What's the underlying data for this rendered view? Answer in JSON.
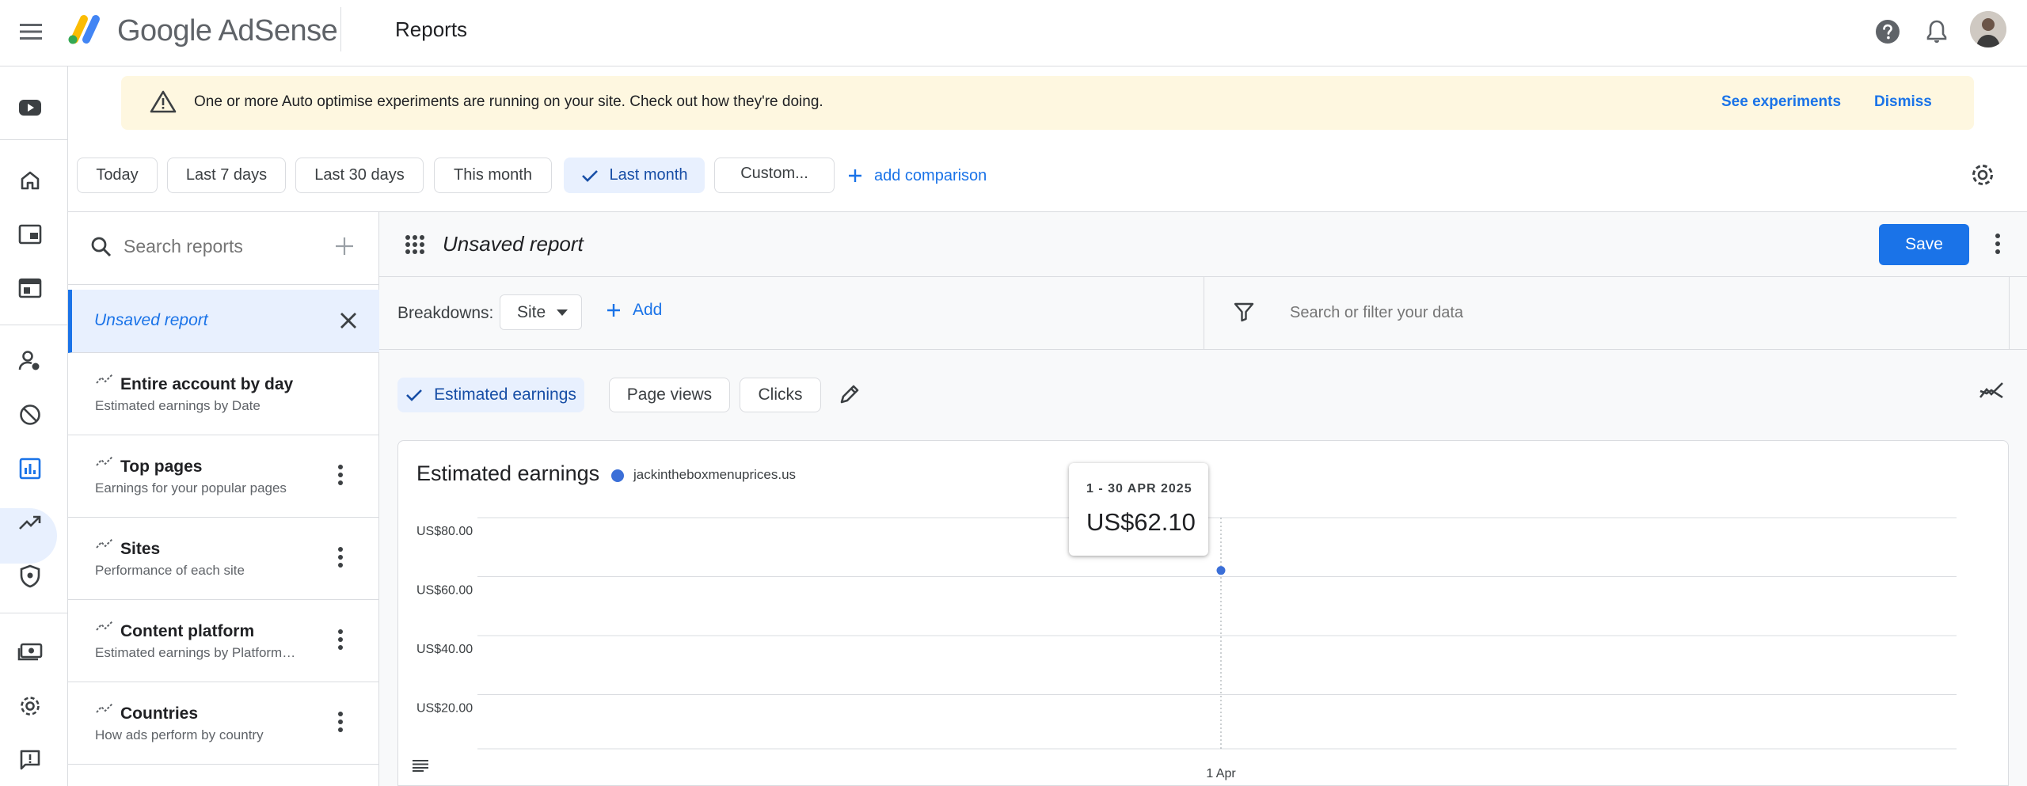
{
  "app": {
    "brand": "Google AdSense",
    "page_title": "Reports"
  },
  "banner": {
    "text": "One or more Auto optimise experiments are running on your site. Check out how they're doing.",
    "see_experiments": "See experiments",
    "dismiss": "Dismiss"
  },
  "date_ranges": [
    {
      "label": "Today",
      "selected": false
    },
    {
      "label": "Last 7 days",
      "selected": false
    },
    {
      "label": "Last 30 days",
      "selected": false
    },
    {
      "label": "This month",
      "selected": false
    },
    {
      "label": "Last month",
      "selected": true
    },
    {
      "label": "Custom...",
      "selected": false
    }
  ],
  "add_comparison": "add comparison",
  "left_panel": {
    "search_placeholder": "Search reports",
    "active_report": "Unsaved report",
    "reports": [
      {
        "title": "Entire account by day",
        "subtitle": "Estimated earnings by Date"
      },
      {
        "title": "Top pages",
        "subtitle": "Earnings for your popular pages"
      },
      {
        "title": "Sites",
        "subtitle": "Performance of each site"
      },
      {
        "title": "Content platform",
        "subtitle": "Estimated earnings by Platform…"
      },
      {
        "title": "Countries",
        "subtitle": "How ads perform by country"
      }
    ]
  },
  "report": {
    "name": "Unsaved report",
    "save_label": "Save",
    "breakdowns_label": "Breakdowns:",
    "breakdown_value": "Site",
    "add_label": "Add",
    "filter_placeholder": "Search or filter your data",
    "metrics": [
      {
        "label": "Estimated earnings",
        "selected": true
      },
      {
        "label": "Page views",
        "selected": false
      },
      {
        "label": "Clicks",
        "selected": false
      }
    ]
  },
  "chart_data": {
    "type": "line",
    "title": "Estimated earnings",
    "series": [
      {
        "name": "jackintheboxmenuprices.us",
        "color": "#3b6fd8",
        "x": [
          "1 Apr"
        ],
        "values": [
          62.1
        ]
      }
    ],
    "y_ticks": [
      "US$20.00",
      "US$40.00",
      "US$60.00",
      "US$80.00"
    ],
    "y_tick_values": [
      20,
      40,
      60,
      80
    ],
    "x_ticks": [
      "1 Apr"
    ],
    "grid": true,
    "tooltip": {
      "date": "1 - 30 APR 2025",
      "value": "US$62.10"
    }
  }
}
